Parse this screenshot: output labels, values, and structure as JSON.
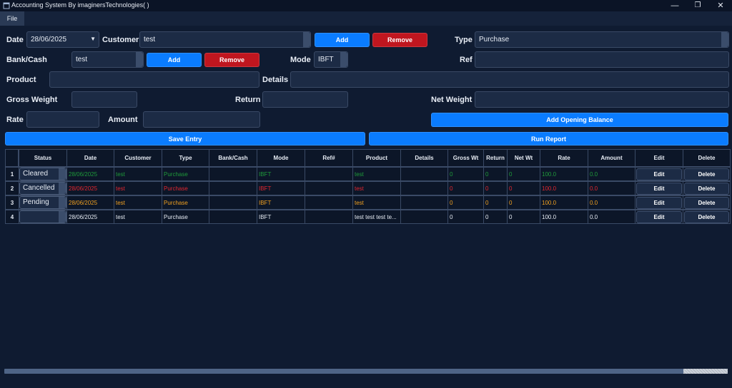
{
  "window": {
    "title": "Accounting System By imaginersTechnologies( )",
    "minimize": "—",
    "maximize": "❐",
    "close": "✕"
  },
  "menu": {
    "file": "File"
  },
  "form": {
    "date_label": "Date",
    "date_value": "28/06/2025",
    "customer_label": "Customer",
    "customer_value": "test",
    "customer_add": "Add",
    "customer_remove": "Remove",
    "type_label": "Type",
    "type_value": "Purchase",
    "bank_label": "Bank/Cash",
    "bank_value": "test",
    "bank_add": "Add",
    "bank_remove": "Remove",
    "mode_label": "Mode",
    "mode_value": "IBFT",
    "ref_label": "Ref",
    "ref_value": "",
    "product_label": "Product",
    "product_value": "",
    "details_label": "Details",
    "details_value": "",
    "gross_label": "Gross Weight",
    "gross_value": "",
    "return_label": "Return",
    "return_value": "",
    "net_label": "Net Weight",
    "net_value": "",
    "rate_label": "Rate",
    "rate_value": "",
    "amount_label": "Amount",
    "amount_value": "",
    "opening_balance": "Add Opening Balance",
    "save_entry": "Save Entry",
    "run_report": "Run Report"
  },
  "table": {
    "headers": [
      "Status",
      "Date",
      "Customer",
      "Type",
      "Bank/Cash",
      "Mode",
      "Ref#",
      "Product",
      "Details",
      "Gross Wt",
      "Return",
      "Net Wt",
      "Rate",
      "Amount",
      "Edit",
      "Delete"
    ],
    "rows": [
      {
        "num": "1",
        "status": "Cleared",
        "color": "#1f9a3a",
        "date": "28/06/2025",
        "customer": "test",
        "type": "Purchase",
        "bank": "",
        "mode": "IBFT",
        "ref": "",
        "product": "test",
        "details": "",
        "gross": "0",
        "return": "0",
        "net": "0",
        "rate": "100.0",
        "amount": "0.0",
        "edit": "Edit",
        "delete": "Delete"
      },
      {
        "num": "2",
        "status": "Cancelled",
        "color": "#e0262f",
        "date": "28/06/2025",
        "customer": "test",
        "type": "Purchase",
        "bank": "",
        "mode": "IBFT",
        "ref": "",
        "product": "test",
        "details": "",
        "gross": "0",
        "return": "0",
        "net": "0",
        "rate": "100.0",
        "amount": "0.0",
        "edit": "Edit",
        "delete": "Delete"
      },
      {
        "num": "3",
        "status": "Pending",
        "color": "#f0a020",
        "date": "28/06/2025",
        "customer": "test",
        "type": "Purchase",
        "bank": "",
        "mode": "IBFT",
        "ref": "",
        "product": "test",
        "details": "",
        "gross": "0",
        "return": "0",
        "net": "0",
        "rate": "100.0",
        "amount": "0.0",
        "edit": "Edit",
        "delete": "Delete"
      },
      {
        "num": "4",
        "status": "",
        "color": "#e6ebf3",
        "date": "28/06/2025",
        "customer": "test",
        "type": "Purchase",
        "bank": "",
        "mode": "IBFT",
        "ref": "",
        "product": "test test test te...",
        "details": "",
        "gross": "0",
        "return": "0",
        "net": "0",
        "rate": "100.0",
        "amount": "0.0",
        "edit": "Edit",
        "delete": "Delete"
      }
    ]
  },
  "colors": {
    "background": "#0f1b31",
    "accent_blue": "#0a7cff",
    "danger_red": "#c0161f",
    "cleared": "#1f9a3a",
    "cancelled": "#e0262f",
    "pending": "#f0a020"
  },
  "icons": {
    "app": "app-window-icon",
    "dropdown": "chevron-down-icon"
  }
}
